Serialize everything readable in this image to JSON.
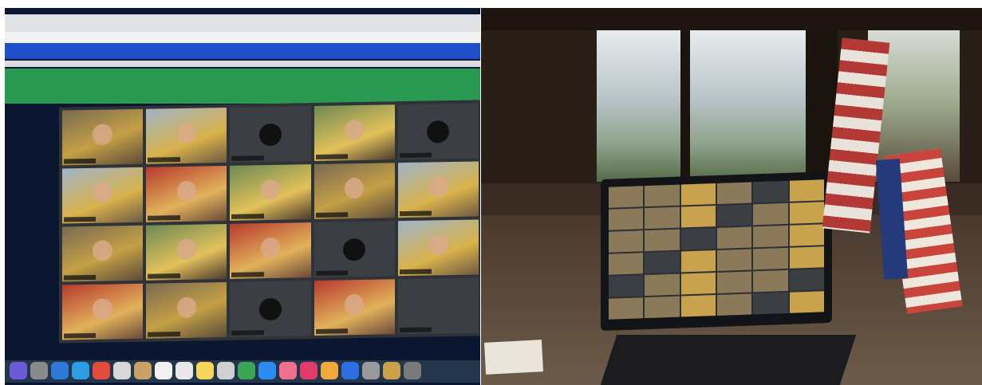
{
  "photos": [
    {
      "name": "monitor-zoom-gallery"
    },
    {
      "name": "laptop-zoom-on-desk"
    }
  ],
  "colors": {
    "zoom_grid_bg": "#2f3236",
    "monitor_frame": "#0b1730",
    "room_wood": "#2a1f17"
  }
}
